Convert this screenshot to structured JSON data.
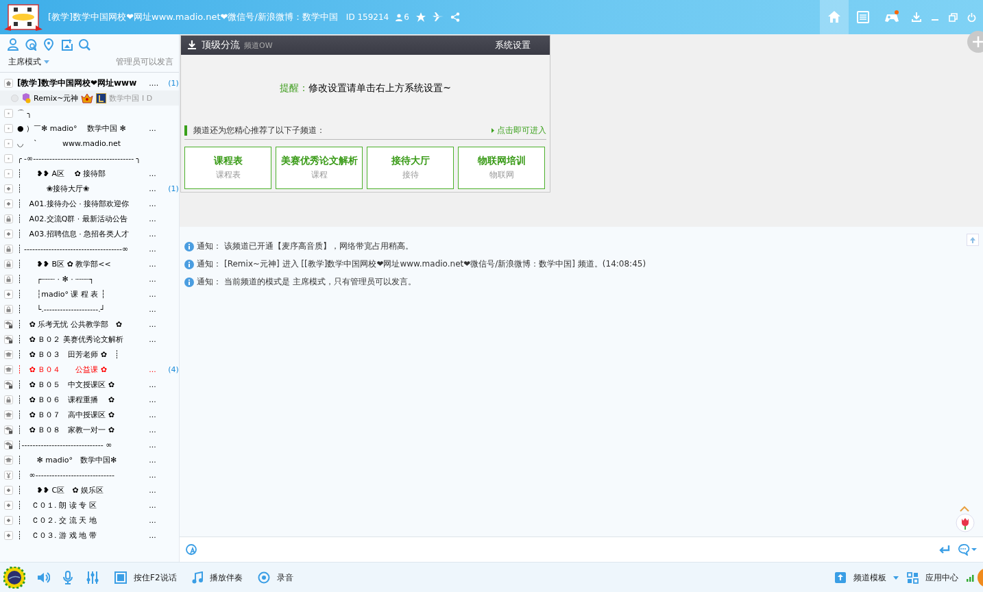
{
  "title_bar": {
    "title": "[教学]数学中国网校❤网址www.madio.net❤微信号/新浪微博：数学中国",
    "channel_id": "ID 159214",
    "member_count": "6",
    "nav": [
      {
        "selected": true
      },
      {
        "selected": false
      },
      {
        "selected": false
      }
    ]
  },
  "sidebar": {
    "mode": "主席模式",
    "mode_note": "管理员可以发言",
    "tree": {
      "kind": "home",
      "name": "[教学]数学中国网校❤网址www",
      "ellipsis": "....",
      "count": "(1)",
      "user": {
        "name": "Remix~元神",
        "tag": "数学中国 I D"
      },
      "children": [
        {
          "kind": "dot",
          "name": "⌒ ╮",
          "highlighted": false
        },
        {
          "kind": "dot",
          "name": "● ）￣✻ madio°　 数学中国 ✻",
          "ellipsis": "...",
          "highlighted": false
        },
        {
          "kind": "dot",
          "name": "◡　 ˋ　　　 www.madio.net",
          "highlighted": false
        },
        {
          "kind": "dot",
          "name": "╭ -∞------------------------------------- ╮",
          "highlighted": false
        },
        {
          "kind": "dot",
          "name": "┊　　❥❥ A区　 ✿ 接待部",
          "ellipsis": "...",
          "highlighted": false
        },
        {
          "kind": "plus",
          "name": "┊　　　 ❀接待大厅❀",
          "ellipsis": "...",
          "count": "(1)",
          "highlighted": false
        },
        {
          "kind": "plus",
          "name": "┊　A01.接待办公 · 接待部欢迎你",
          "ellipsis": "...",
          "highlighted": false
        },
        {
          "kind": "lock",
          "name": "┊　A02.交流Q群 · 最新活动公告",
          "ellipsis": "...",
          "highlighted": false
        },
        {
          "kind": "plus",
          "name": "┊　A03.招聘信息 · 急招各类人才",
          "ellipsis": "...",
          "highlighted": false
        },
        {
          "kind": "lock",
          "name": "┊ ------------------------------------∞",
          "ellipsis": "...",
          "highlighted": false
        },
        {
          "kind": "lock",
          "name": "┊　　❥❥ B区 ✿ 教学部<<",
          "ellipsis": "...",
          "highlighted": false
        },
        {
          "kind": "lock",
          "name": "┊　　┌┈┈┈ · ✻ · ┈┈┈┐",
          "ellipsis": "...",
          "highlighted": false
        },
        {
          "kind": "plus",
          "name": "┊　　┆madio° 课 程 表 ┆",
          "ellipsis": "...",
          "highlighted": false
        },
        {
          "kind": "lock",
          "name": "┊　　└.--------------------.┘",
          "ellipsis": "...",
          "highlighted": false
        },
        {
          "kind": "grad_lock",
          "name": "┊　✿ 乐考无忧 公共教学部　✿",
          "ellipsis": "...",
          "highlighted": false
        },
        {
          "kind": "grad_lock",
          "name": "┊　✿ Ｂ０２ 美赛优秀论文解析",
          "ellipsis": "...",
          "highlighted": false
        },
        {
          "kind": "grad",
          "name": "┊　✿ Ｂ０３　田芳老师 ✿　┊",
          "highlighted": false
        },
        {
          "kind": "grad",
          "name": "┊　✿ Ｂ０４　　公益课 ✿",
          "ellipsis": "...",
          "count": "(4)",
          "highlighted": true
        },
        {
          "kind": "grad_lock",
          "name": "┊　✿ Ｂ０５　中文授课区 ✿",
          "ellipsis": "...",
          "highlighted": false
        },
        {
          "kind": "lock",
          "name": "┊　✿ Ｂ０６　课程重播　 ✿",
          "ellipsis": "...",
          "highlighted": false
        },
        {
          "kind": "grad",
          "name": "┊　✿ Ｂ０７　高中授课区 ✿",
          "ellipsis": "...",
          "highlighted": false
        },
        {
          "kind": "grad_lock",
          "name": "┊　✿ Ｂ０８　家教一对一 ✿",
          "ellipsis": "...",
          "highlighted": false
        },
        {
          "kind": "grad_lock",
          "name": "┊------------------------------ ∞",
          "ellipsis": "...",
          "highlighted": false
        },
        {
          "kind": "grad",
          "name": "┊　　✻ madio°　数学中国✻",
          "ellipsis": "...",
          "highlighted": false
        },
        {
          "kind": "yen",
          "name": "┊　∞-----------------------------",
          "ellipsis": "...",
          "highlighted": false
        },
        {
          "kind": "plus",
          "name": "┊　　❥❥ C区　✿ 娱乐区",
          "ellipsis": "...",
          "highlighted": false
        },
        {
          "kind": "plus",
          "name": "┊　 Ｃ０１. 朗 读 专 区",
          "ellipsis": "...",
          "highlighted": false
        },
        {
          "kind": "plus",
          "name": "┊　 Ｃ０２. 交 流 天 地",
          "ellipsis": "...",
          "highlighted": false
        },
        {
          "kind": "plus",
          "name": "┊　 Ｃ０３. 游 戏 地 带",
          "ellipsis": "...",
          "highlighted": false
        }
      ]
    }
  },
  "panel": {
    "title": "顶级分流",
    "subtitle": "频道OW",
    "settings": "系统设置",
    "reminder_label": "提醒：",
    "reminder": "修改设置请单击右上方系统设置~",
    "recommend": "频道还为您精心推荐了以下子频道：",
    "enter_link": "点击即可进入",
    "cards": [
      {
        "title": "课程表",
        "subtitle": "课程表"
      },
      {
        "title": "美赛优秀论文解析",
        "subtitle": "课程"
      },
      {
        "title": "接待大厅",
        "subtitle": "接待"
      },
      {
        "title": "物联网培训",
        "subtitle": "物联网"
      }
    ]
  },
  "chat": {
    "notices": [
      {
        "label": "通知：",
        "text": "该频道已开通【麦序高音质】，网络带宽占用稍高。"
      },
      {
        "label": "通知：",
        "text": " [Remix~元神] 进入 [[教学]数学中国网校❤网址www.madio.net❤微信号/新浪微博：数学中国] 频道。(14:08:45)"
      },
      {
        "label": "通知：",
        "text": "当前频道的模式是 主席模式，只有管理员可以发言。"
      }
    ]
  },
  "bottom_bar": {
    "talk": "按住F2说话",
    "music": "播放伴奏",
    "record": "录音",
    "template": "频道模板",
    "apps": "应用中心"
  }
}
